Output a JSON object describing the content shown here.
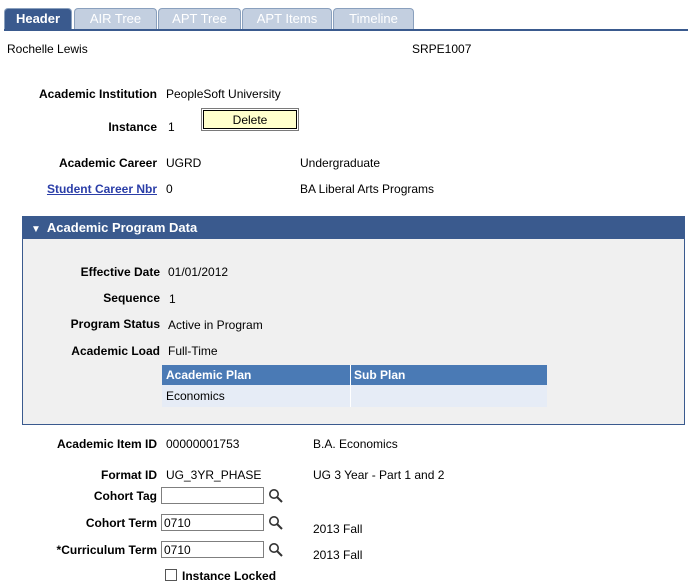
{
  "tabs": [
    {
      "label": "Header",
      "active": true
    },
    {
      "label": "AIR Tree",
      "active": false
    },
    {
      "label": "APT Tree",
      "active": false
    },
    {
      "label": "APT Items",
      "active": false
    },
    {
      "label": "Timeline",
      "active": false
    }
  ],
  "student": {
    "name": "Rochelle Lewis",
    "id": "SRPE1007"
  },
  "institution": {
    "label": "Academic Institution",
    "value": "PeopleSoft University"
  },
  "instance": {
    "label": "Instance",
    "value": "1",
    "delete_label": "Delete"
  },
  "career": {
    "label": "Academic Career",
    "value": "UGRD",
    "desc": "Undergraduate"
  },
  "career_nbr": {
    "label": "Student Career Nbr",
    "value": "0",
    "desc": "BA Liberal Arts Programs"
  },
  "program": {
    "title": "Academic Program Data",
    "effective_date": {
      "label": "Effective Date",
      "value": "01/01/2012"
    },
    "sequence": {
      "label": "Sequence",
      "value": "1"
    },
    "status": {
      "label": "Program Status",
      "value": "Active in Program"
    },
    "load": {
      "label": "Academic Load",
      "value": "Full-Time"
    },
    "grid": {
      "headers": [
        "Academic Plan",
        "Sub Plan"
      ],
      "rows": [
        [
          "Economics",
          ""
        ]
      ]
    }
  },
  "item": {
    "label": "Academic Item ID",
    "value": "00000001753",
    "desc": "B.A. Economics"
  },
  "format": {
    "label": "Format ID",
    "value": "UG_3YR_PHASE",
    "desc": "UG 3 Year - Part 1 and 2"
  },
  "cohort_tag": {
    "label": "Cohort Tag",
    "value": ""
  },
  "cohort_term": {
    "label": "Cohort Term",
    "value": "0710",
    "desc": "2013 Fall"
  },
  "curriculum_term": {
    "label": "*Curriculum Term",
    "value": "0710",
    "desc": "2013 Fall"
  },
  "instance_locked": {
    "label": "Instance Locked",
    "checked": false
  },
  "colors": {
    "tab_active": "#3a5a8e",
    "tab_inactive": "#c3cfe0",
    "grid_header": "#4a7ab5",
    "button": "#ffffcc",
    "link": "#2b3ea8"
  }
}
